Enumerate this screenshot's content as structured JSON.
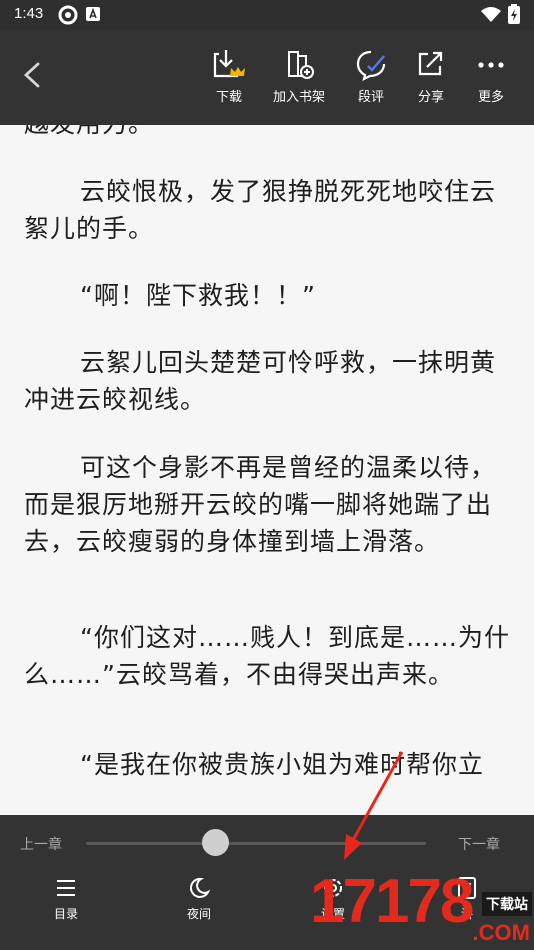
{
  "status": {
    "time": "1:43"
  },
  "toolbar": {
    "download": "下载",
    "bookshelf": "加入书架",
    "comment": "段评",
    "share": "分享",
    "more": "更多"
  },
  "content": {
    "top_partial": "越发用力。",
    "paragraphs": [
      "云皎恨极，发了狠挣脱死死地咬住云絮儿的手。",
      "“啊！陛下救我！！”",
      "云絮儿回头楚楚可怜呼救，一抹明黄冲进云皎视线。",
      "可这个身影不再是曾经的温柔以待，而是狠厉地掰开云皎的嘴一脚将她踹了出去，云皎瘦弱的身体撞到墙上滑落。",
      "“你们这对……贱人！到底是……为什么……”云皎骂着，不由得哭出声来。",
      "“是我在你被贵族小姐为难时帮你立"
    ]
  },
  "bottom": {
    "prev_chapter": "上一章",
    "next_chapter": "下一章",
    "progress": 0.38,
    "catalog": "目录",
    "night": "夜间",
    "settings": "设置",
    "notes": "讲"
  },
  "watermark": {
    "number": "17178",
    "badge": "下载站",
    "domain": ".COM"
  },
  "colors": {
    "bar": "#333333",
    "page": "#f6f6f6",
    "arrow": "#e8261b",
    "crown": "#f2b400",
    "comment_check": "#4a7cf3"
  }
}
